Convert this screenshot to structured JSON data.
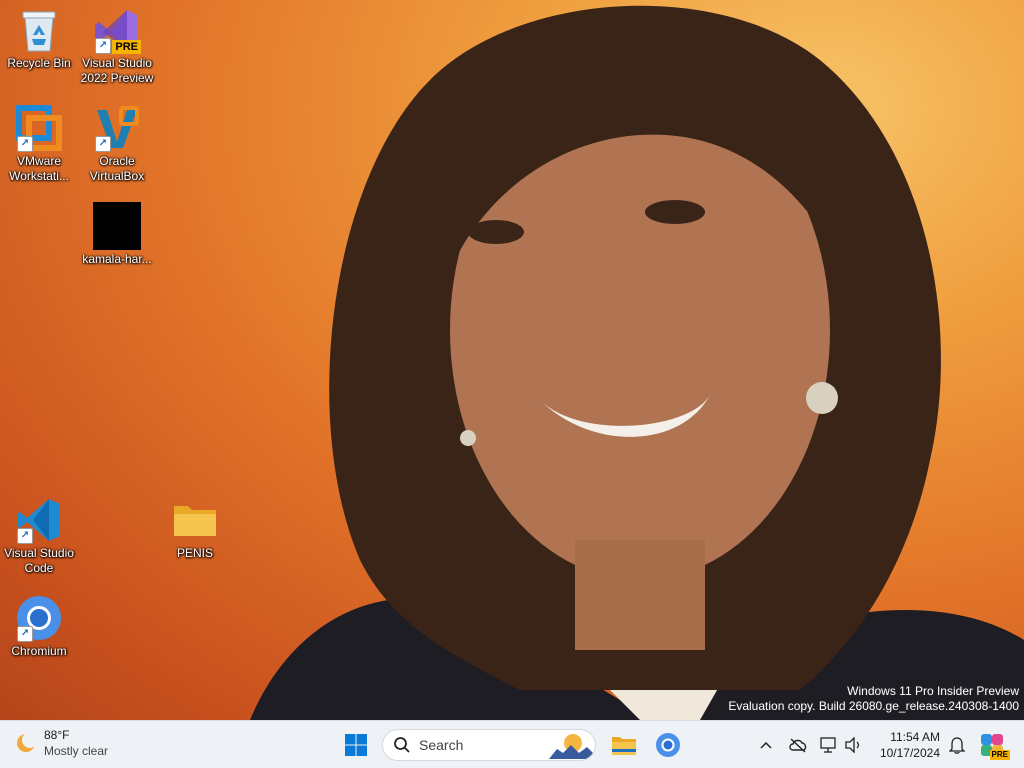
{
  "desktop": {
    "icons": [
      {
        "label": "Recycle Bin",
        "icon": "recycle-bin-icon"
      },
      {
        "label": "Visual Studio 2022 Preview",
        "icon": "visual-studio-preview-icon",
        "badge": "PRE"
      },
      {
        "label": "VMware Workstati...",
        "icon": "vmware-icon"
      },
      {
        "label": "Oracle VirtualBox",
        "icon": "virtualbox-icon"
      },
      {
        "label": "kamala-har...",
        "icon": "image-file-icon"
      },
      {
        "label": "Visual Studio Code",
        "icon": "vscode-icon"
      },
      {
        "label": "PENIS",
        "icon": "folder-icon"
      },
      {
        "label": "Chromium",
        "icon": "chromium-icon"
      }
    ],
    "watermark": {
      "line1": "Windows 11 Pro Insider Preview",
      "line2": "Evaluation copy. Build 26080.ge_release.240308-1400"
    }
  },
  "taskbar": {
    "weather": {
      "temp": "88°F",
      "condition": "Mostly clear"
    },
    "search_placeholder": "Search",
    "clock": {
      "time": "11:54 AM",
      "date": "10/17/2024"
    },
    "copilot_badge": "PRE"
  },
  "colors": {
    "accent": "#0067c0",
    "taskbar_bg": "#eef1f5",
    "folder": "#f5c44e"
  }
}
